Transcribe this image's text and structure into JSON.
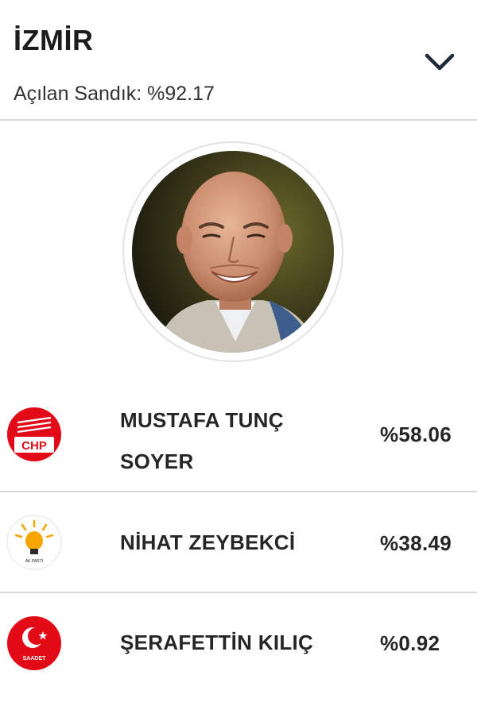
{
  "header": {
    "city": "İZMİR",
    "opened_ballot_label": "Açılan Sandık: %92.17",
    "toggle_icon": "chevron-down-icon"
  },
  "featured_candidate": {
    "photo": "candidate-portrait"
  },
  "candidates": [
    {
      "name": "MUSTAFA TUNÇ SOYER",
      "percent": "%58.06",
      "party_logo_text": "CHP",
      "logo_color": "#e30a17"
    },
    {
      "name": "NİHAT ZEYBEKCİ",
      "percent": "%38.49",
      "party_logo_text": "AK PARTİ",
      "logo_color": "#f7a600"
    },
    {
      "name": "ŞERAFETTİN KILIÇ",
      "percent": "%0.92",
      "party_logo_text": "SAADET",
      "logo_color": "#e30a17"
    }
  ]
}
